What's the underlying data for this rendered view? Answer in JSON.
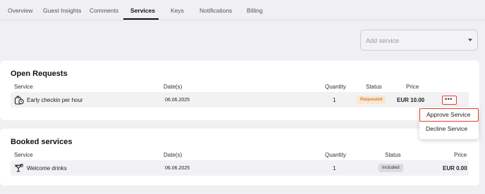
{
  "tabs": [
    {
      "label": "Overview"
    },
    {
      "label": "Guest Insights"
    },
    {
      "label": "Comments"
    },
    {
      "label": "Services"
    },
    {
      "label": "Keys"
    },
    {
      "label": "Notifications"
    },
    {
      "label": "Billing"
    }
  ],
  "active_tab": "Services",
  "add_service": {
    "placeholder": "Add service"
  },
  "open_requests": {
    "title": "Open Requests",
    "headers": {
      "service": "Service",
      "date": "Date(s)",
      "quantity": "Quantity",
      "status": "Status",
      "price": "Price"
    },
    "rows": [
      {
        "service": "Early checkin per hour",
        "icon": "luggage-clock-icon",
        "date": "06.06.2025",
        "quantity": "1",
        "status": "Requested",
        "price": "EUR 10.00"
      }
    ],
    "more_button": "•••"
  },
  "menu": {
    "items": [
      {
        "label": "Approve Service"
      },
      {
        "label": "Decline Service"
      }
    ]
  },
  "booked_services": {
    "title": "Booked services",
    "headers": {
      "service": "Service",
      "date": "Date(s)",
      "quantity": "Quantity",
      "status": "Status",
      "price": "Price"
    },
    "rows": [
      {
        "service": "Welcome drinks",
        "icon": "cocktail-glass-icon",
        "date": "06.06.2025",
        "quantity": "1",
        "status": "Included",
        "price": "EUR 0.00"
      }
    ]
  },
  "colors": {
    "accent": "#e53e2a",
    "requested_bg": "#fbe6cf",
    "requested_fg": "#b5651d",
    "included_bg": "#dcdcde"
  }
}
